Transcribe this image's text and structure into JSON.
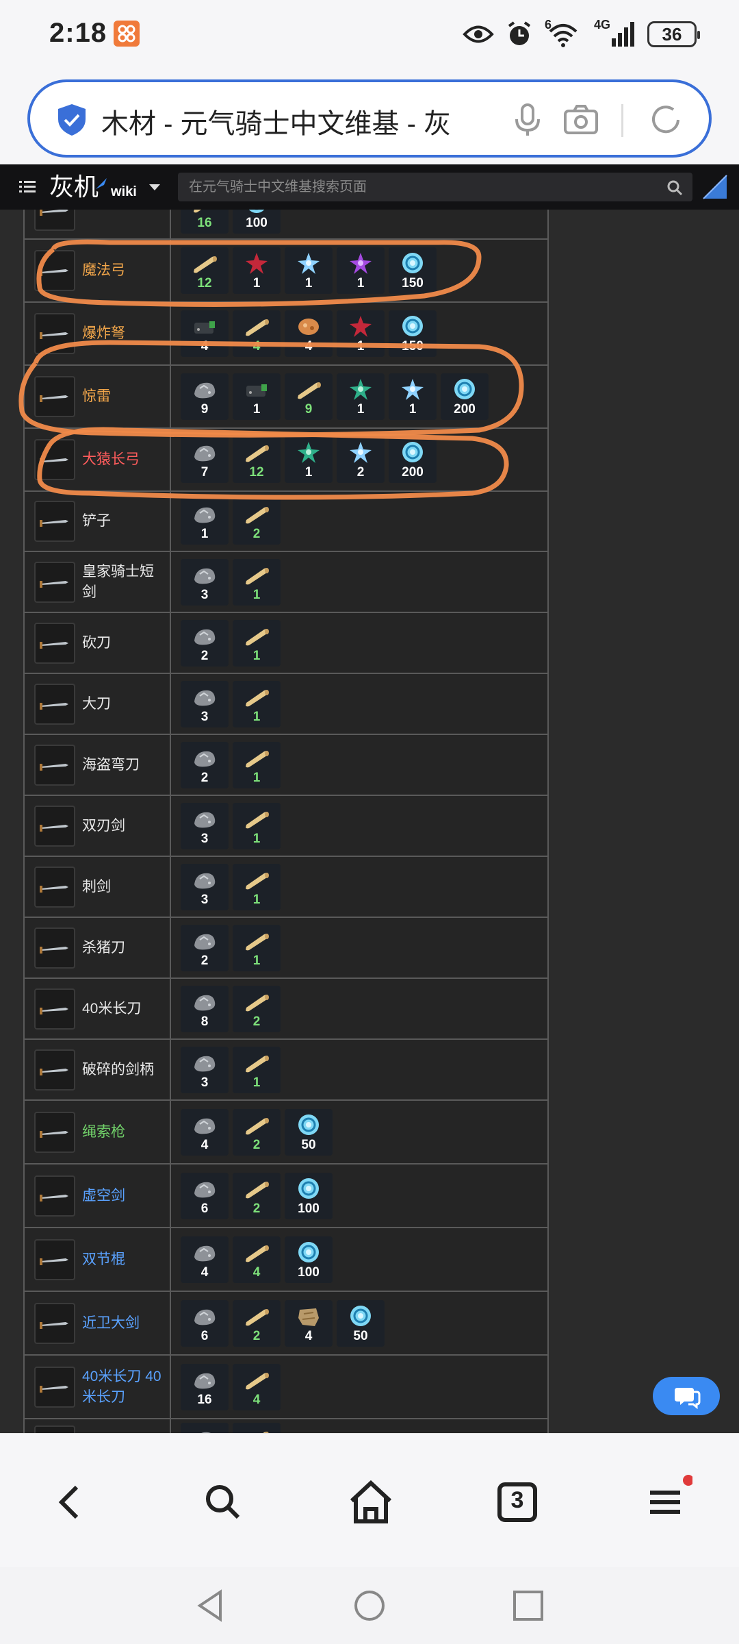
{
  "status": {
    "time": "2:18",
    "battery": "36",
    "network": "4G",
    "wifi_badge": "6"
  },
  "browser": {
    "url_title": "木材 - 元气骑士中文维基 - 灰"
  },
  "wiki": {
    "logo_cn": "灰机",
    "logo_en": "wiki",
    "search_placeholder": "在元气骑士中文维基搜索页面"
  },
  "rows": [
    {
      "name": "",
      "color": "white",
      "height": 84,
      "mats": [
        {
          "icon": "wood-icon",
          "count": "16",
          "green": true
        },
        {
          "icon": "energy-icon",
          "count": "100",
          "green": false
        }
      ]
    },
    {
      "name": "魔法弓",
      "color": "orange",
      "height": 92,
      "mats": [
        {
          "icon": "wood-icon",
          "count": "12",
          "green": true
        },
        {
          "icon": "red-crystal-icon",
          "count": "1"
        },
        {
          "icon": "blue-crystal-icon",
          "count": "1"
        },
        {
          "icon": "purple-crystal-icon",
          "count": "1"
        },
        {
          "icon": "energy-icon",
          "count": "150"
        }
      ]
    },
    {
      "name": "爆炸弩",
      "color": "orange",
      "height": 92,
      "mats": [
        {
          "icon": "battery-icon",
          "count": "4"
        },
        {
          "icon": "wood-icon",
          "count": "4",
          "green": true
        },
        {
          "icon": "ore-icon",
          "count": "4"
        },
        {
          "icon": "red-crystal-icon",
          "count": "1"
        },
        {
          "icon": "energy-icon",
          "count": "150"
        }
      ]
    },
    {
      "name": "惊雷",
      "color": "orange",
      "height": 92,
      "mats": [
        {
          "icon": "iron-icon",
          "count": "9"
        },
        {
          "icon": "battery-icon",
          "count": "1"
        },
        {
          "icon": "wood-icon",
          "count": "9",
          "green": true
        },
        {
          "icon": "green-crystal-icon",
          "count": "1"
        },
        {
          "icon": "blue-crystal-icon",
          "count": "1"
        },
        {
          "icon": "energy-icon",
          "count": "200"
        }
      ]
    },
    {
      "name": "大猿长弓",
      "color": "red",
      "height": 92,
      "mats": [
        {
          "icon": "iron-icon",
          "count": "7"
        },
        {
          "icon": "wood-icon",
          "count": "12",
          "green": true
        },
        {
          "icon": "green-crystal-icon",
          "count": "1"
        },
        {
          "icon": "blue-crystal-icon",
          "count": "2"
        },
        {
          "icon": "energy-icon",
          "count": "200"
        }
      ]
    },
    {
      "name": "铲子",
      "color": "white",
      "height": 88,
      "mats": [
        {
          "icon": "iron-icon",
          "count": "1"
        },
        {
          "icon": "wood-icon",
          "count": "2",
          "green": true
        }
      ]
    },
    {
      "name": "皇家骑士短剑",
      "color": "white",
      "height": 89,
      "mats": [
        {
          "icon": "iron-icon",
          "count": "3"
        },
        {
          "icon": "wood-icon",
          "count": "1",
          "green": true
        }
      ]
    },
    {
      "name": "砍刀",
      "color": "white",
      "height": 89,
      "mats": [
        {
          "icon": "iron-icon",
          "count": "2"
        },
        {
          "icon": "wood-icon",
          "count": "1",
          "green": true
        }
      ]
    },
    {
      "name": "大刀",
      "color": "white",
      "height": 89,
      "mats": [
        {
          "icon": "iron-icon",
          "count": "3"
        },
        {
          "icon": "wood-icon",
          "count": "1",
          "green": true
        }
      ]
    },
    {
      "name": "海盗弯刀",
      "color": "white",
      "height": 89,
      "mats": [
        {
          "icon": "iron-icon",
          "count": "2"
        },
        {
          "icon": "wood-icon",
          "count": "1",
          "green": true
        }
      ]
    },
    {
      "name": "双刃剑",
      "color": "white",
      "height": 89,
      "mats": [
        {
          "icon": "iron-icon",
          "count": "3"
        },
        {
          "icon": "wood-icon",
          "count": "1",
          "green": true
        }
      ]
    },
    {
      "name": "刺剑",
      "color": "white",
      "height": 89,
      "mats": [
        {
          "icon": "iron-icon",
          "count": "3"
        },
        {
          "icon": "wood-icon",
          "count": "1",
          "green": true
        }
      ]
    },
    {
      "name": "杀猪刀",
      "color": "white",
      "height": 89,
      "mats": [
        {
          "icon": "iron-icon",
          "count": "2"
        },
        {
          "icon": "wood-icon",
          "count": "1",
          "green": true
        }
      ]
    },
    {
      "name": "40米长刀",
      "color": "white",
      "height": 89,
      "mats": [
        {
          "icon": "iron-icon",
          "count": "8"
        },
        {
          "icon": "wood-icon",
          "count": "2",
          "green": true
        }
      ]
    },
    {
      "name": "破碎的剑柄",
      "color": "white",
      "height": 89,
      "mats": [
        {
          "icon": "iron-icon",
          "count": "3"
        },
        {
          "icon": "wood-icon",
          "count": "1",
          "green": true
        }
      ]
    },
    {
      "name": "绳索枪",
      "color": "green",
      "height": 93,
      "mats": [
        {
          "icon": "iron-icon",
          "count": "4"
        },
        {
          "icon": "wood-icon",
          "count": "2",
          "green": true
        },
        {
          "icon": "energy-icon",
          "count": "50"
        }
      ]
    },
    {
      "name": "虚空剑",
      "color": "blue",
      "height": 93,
      "mats": [
        {
          "icon": "iron-icon",
          "count": "6"
        },
        {
          "icon": "wood-icon",
          "count": "2",
          "green": true
        },
        {
          "icon": "energy-icon",
          "count": "100"
        }
      ]
    },
    {
      "name": "双节棍",
      "color": "blue",
      "height": 93,
      "mats": [
        {
          "icon": "iron-icon",
          "count": "4"
        },
        {
          "icon": "wood-icon",
          "count": "4",
          "green": true
        },
        {
          "icon": "energy-icon",
          "count": "100"
        }
      ]
    },
    {
      "name": "近卫大剑",
      "color": "blue",
      "height": 93,
      "mats": [
        {
          "icon": "iron-icon",
          "count": "6"
        },
        {
          "icon": "wood-icon",
          "count": "2",
          "green": true
        },
        {
          "icon": "hide-icon",
          "count": "4"
        },
        {
          "icon": "energy-icon",
          "count": "50"
        }
      ]
    },
    {
      "name": "40米长刀 40米长刀",
      "color": "blue",
      "height": 93,
      "mats": [
        {
          "icon": "iron-icon",
          "count": "16"
        },
        {
          "icon": "wood-icon",
          "count": "4",
          "green": true
        }
      ]
    },
    {
      "name": "",
      "color": "white",
      "height": 80,
      "mats": [
        {
          "icon": "iron-icon",
          "count": ""
        },
        {
          "icon": "wood-icon",
          "count": ""
        }
      ]
    }
  ],
  "bottom_nav": {
    "tabs_count": "3"
  }
}
